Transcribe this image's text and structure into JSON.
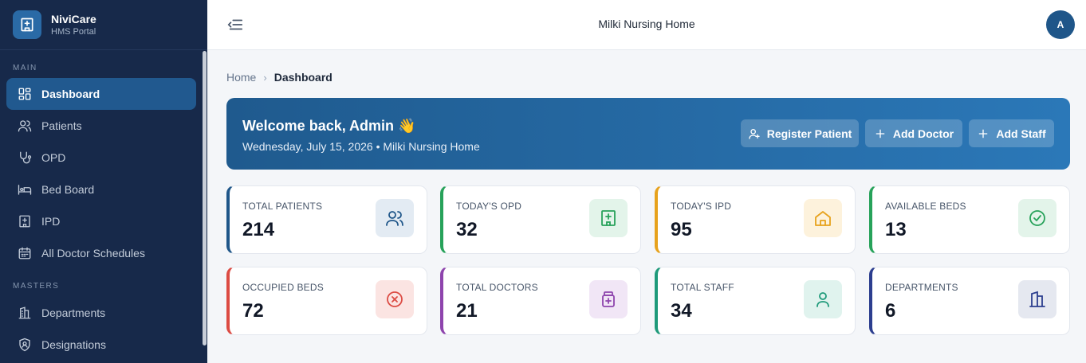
{
  "brand": {
    "name": "NiviCare",
    "subtitle": "HMS Portal"
  },
  "sidebar": {
    "sections": [
      {
        "label": "MAIN"
      },
      {
        "label": "MASTERS"
      }
    ],
    "items": [
      {
        "label": "Dashboard",
        "icon": "dashboard-icon",
        "active": true
      },
      {
        "label": "Patients",
        "icon": "users-icon"
      },
      {
        "label": "OPD",
        "icon": "stethoscope-icon"
      },
      {
        "label": "Bed Board",
        "icon": "bed-icon"
      },
      {
        "label": "IPD",
        "icon": "hospital-icon"
      },
      {
        "label": "All Doctor Schedules",
        "icon": "calendar-icon"
      },
      {
        "label": "Departments",
        "icon": "building-icon"
      },
      {
        "label": "Designations",
        "icon": "shield-user-icon"
      }
    ]
  },
  "header": {
    "title": "Milki Nursing Home",
    "avatar_initial": "A"
  },
  "breadcrumb": {
    "home": "Home",
    "current": "Dashboard"
  },
  "welcome": {
    "title": "Welcome back, Admin 👋",
    "subtitle": "Wednesday, July 15, 2026 • Milki Nursing Home",
    "buttons": [
      {
        "label": "Register Patient",
        "icon": "user-plus-icon"
      },
      {
        "label": "Add Doctor",
        "icon": "plus-icon"
      },
      {
        "label": "Add Staff",
        "icon": "plus-icon"
      }
    ]
  },
  "stats": [
    {
      "label": "TOTAL PATIENTS",
      "value": "214",
      "icon": "users-icon",
      "accent": "#1f5689",
      "icon_bg": "#e3ebf3"
    },
    {
      "label": "TODAY'S OPD",
      "value": "32",
      "icon": "hospital-icon",
      "accent": "#27a25a",
      "icon_bg": "#e3f4ea"
    },
    {
      "label": "TODAY'S IPD",
      "value": "95",
      "icon": "home-icon",
      "accent": "#e7a21c",
      "icon_bg": "#fdf2dc"
    },
    {
      "label": "AVAILABLE BEDS",
      "value": "13",
      "icon": "check-circle-icon",
      "accent": "#27a25a",
      "icon_bg": "#e3f4ea"
    },
    {
      "label": "OCCUPIED BEDS",
      "value": "72",
      "icon": "x-circle-icon",
      "accent": "#dc4b43",
      "icon_bg": "#fbe4e2"
    },
    {
      "label": "TOTAL DOCTORS",
      "value": "21",
      "icon": "medicine-icon",
      "accent": "#8e44ad",
      "icon_bg": "#f1e6f6"
    },
    {
      "label": "TOTAL STAFF",
      "value": "34",
      "icon": "user-icon",
      "accent": "#1e9a7a",
      "icon_bg": "#e0f3ee"
    },
    {
      "label": "DEPARTMENTS",
      "value": "6",
      "icon": "building-icon",
      "accent": "#2c3e8f",
      "icon_bg": "#e5e8f0"
    }
  ]
}
